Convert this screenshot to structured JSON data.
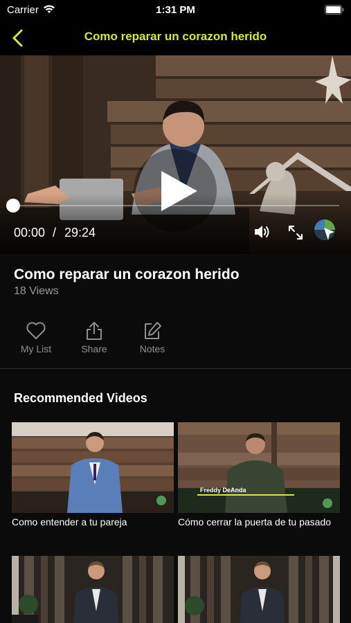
{
  "status_bar": {
    "carrier": "Carrier",
    "time": "1:31 PM"
  },
  "nav": {
    "title": "Como reparar un corazon herido",
    "title_color": "#d6e83a"
  },
  "player": {
    "current_time": "00:00",
    "separator": "/",
    "duration": "29:24",
    "progress": 0.0
  },
  "video": {
    "title": "Como reparar un corazon herido",
    "views": "18 Views"
  },
  "actions": [
    {
      "label": "My List",
      "icon": "heart-icon"
    },
    {
      "label": "Share",
      "icon": "share-icon"
    },
    {
      "label": "Notes",
      "icon": "edit-icon"
    }
  ],
  "recommended": {
    "heading": "Recommended Videos",
    "items": [
      {
        "title": "Como entender a tu pareja"
      },
      {
        "title": "Cómo cerrar la puerta de tu pasado"
      },
      {
        "title": ""
      },
      {
        "title": ""
      }
    ],
    "overlay_name": "Freddy DeAnda"
  }
}
